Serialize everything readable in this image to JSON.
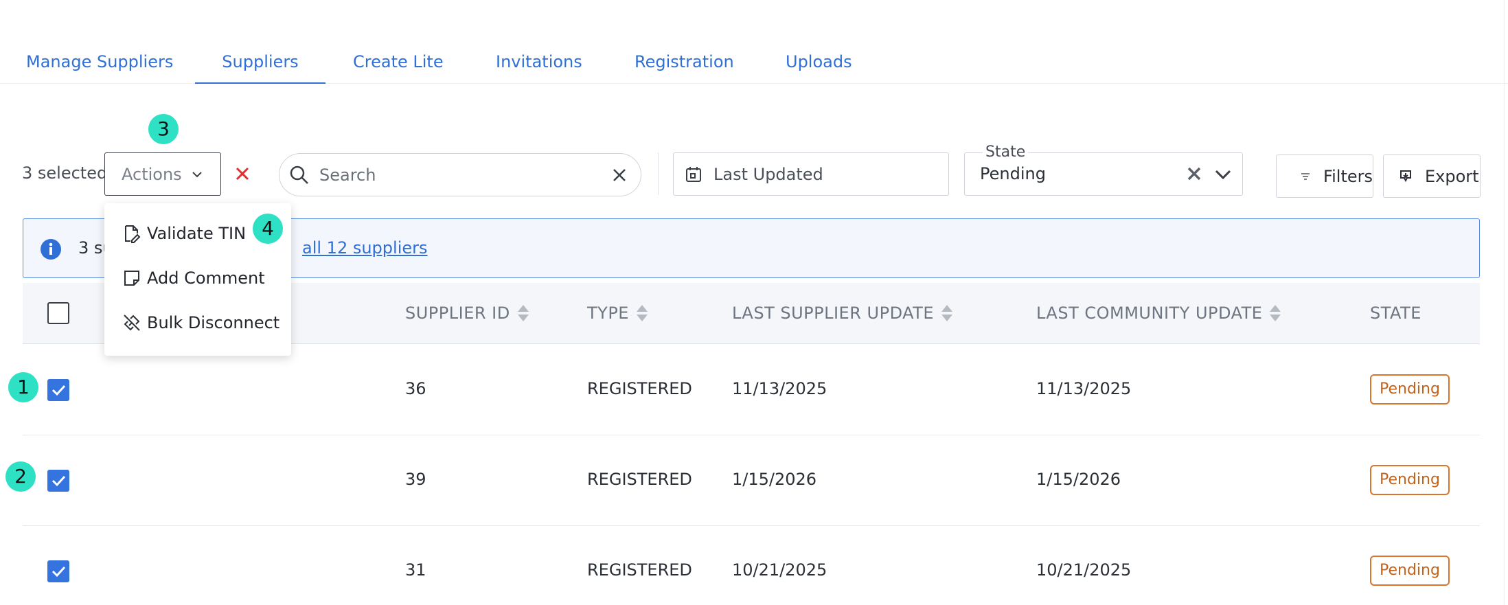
{
  "tabs": [
    {
      "label": "Manage Suppliers",
      "active": false
    },
    {
      "label": "Suppliers",
      "active": true
    },
    {
      "label": "Create Lite",
      "active": false
    },
    {
      "label": "Invitations",
      "active": false
    },
    {
      "label": "Registration",
      "active": false
    },
    {
      "label": "Uploads",
      "active": false
    }
  ],
  "toolbar": {
    "selected_text": "3 selected",
    "actions_label": "Actions",
    "search_placeholder": "Search",
    "date_placeholder": "Last Updated",
    "state_legend": "State",
    "state_value": "Pending",
    "filters_label": "Filters",
    "export_label": "Export"
  },
  "actions_menu": {
    "items": [
      {
        "label": "Validate TIN",
        "icon": "file-edit-icon"
      },
      {
        "label": "Add Comment",
        "icon": "sticky-note-icon"
      },
      {
        "label": "Bulk Disconnect",
        "icon": "unlink-icon"
      }
    ]
  },
  "banner": {
    "text": "3 su",
    "link": "all 12 suppliers"
  },
  "table": {
    "columns": [
      "SUPPLIER ID",
      "TYPE",
      "LAST SUPPLIER UPDATE",
      "LAST COMMUNITY UPDATE",
      "STATE"
    ],
    "rows": [
      {
        "id": "36",
        "type": "REGISTERED",
        "supplier_update": "11/13/2025",
        "community_update": "11/13/2025",
        "state": "Pending",
        "checked": true
      },
      {
        "id": "39",
        "type": "REGISTERED",
        "supplier_update": "1/15/2026",
        "community_update": "1/15/2026",
        "state": "Pending",
        "checked": true
      },
      {
        "id": "31",
        "type": "REGISTERED",
        "supplier_update": "10/21/2025",
        "community_update": "10/21/2025",
        "state": "Pending",
        "checked": true
      }
    ]
  },
  "markers": [
    "1",
    "2",
    "3",
    "4"
  ],
  "colors": {
    "accent": "#2f6fd6",
    "checkbox": "#3574de",
    "pending": "#d9742a",
    "clear_x": "#e0312f",
    "marker": "#2ee0c4"
  }
}
